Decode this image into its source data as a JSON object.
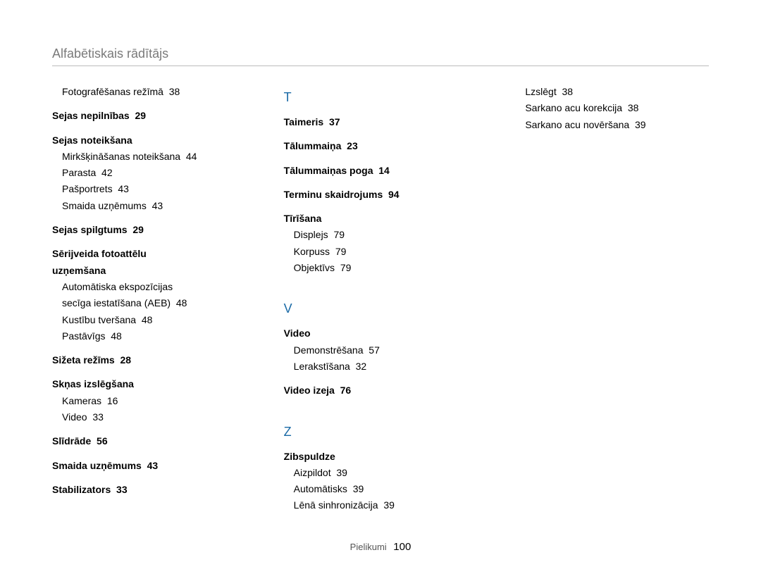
{
  "header": {
    "title": "Alfabētiskais rādītājs"
  },
  "footer": {
    "section": "Pielikumi",
    "page": "100"
  },
  "col1": {
    "e0": {
      "text": "Fotografēšanas režīmā",
      "page": "38"
    },
    "e1": {
      "text": "Sejas nepilnības",
      "page": "29"
    },
    "e2": {
      "text": "Sejas noteikšana"
    },
    "e2s": [
      {
        "text": "Mirkšķināšanas noteikšana",
        "page": "44"
      },
      {
        "text": "Parasta",
        "page": "42"
      },
      {
        "text": "Pašportrets",
        "page": "43"
      },
      {
        "text": "Smaida uzņēmums",
        "page": "43"
      }
    ],
    "e3": {
      "text": "Sejas spilgtums",
      "page": "29"
    },
    "e4a": {
      "text": "Sērijveida fotoattēlu"
    },
    "e4b": {
      "text": "uzņemšana"
    },
    "e4s": [
      {
        "text": "Automātiska ekspozīcijas"
      },
      {
        "text": "secīga iestatīšana (AEB)",
        "page": "48"
      },
      {
        "text": "Kustību tveršana",
        "page": "48"
      },
      {
        "text": "Pastāvīgs",
        "page": "48"
      }
    ],
    "e5": {
      "text": "Sižeta režīms",
      "page": "28"
    },
    "e6": {
      "text": "Skņas izslēgšana"
    },
    "e6s": [
      {
        "text": "Kameras",
        "page": "16"
      },
      {
        "text": "Video",
        "page": "33"
      }
    ],
    "e7": {
      "text": "Slīdrāde",
      "page": "56"
    },
    "e8": {
      "text": "Smaida uzņēmums",
      "page": "43"
    },
    "e9": {
      "text": "Stabilizators",
      "page": "33"
    }
  },
  "col2": {
    "letterT": "T",
    "t1": {
      "text": "Taimeris",
      "page": "37"
    },
    "t2": {
      "text": "Tālummaiņa",
      "page": "23"
    },
    "t3": {
      "text": "Tālummaiņas poga",
      "page": "14"
    },
    "t4": {
      "text": "Terminu skaidrojums",
      "page": "94"
    },
    "t5": {
      "text": "Tīrīšana"
    },
    "t5s": [
      {
        "text": "Displejs",
        "page": "79"
      },
      {
        "text": "Korpuss",
        "page": "79"
      },
      {
        "text": "Objektīvs",
        "page": "79"
      }
    ],
    "letterV": "V",
    "v1": {
      "text": "Video"
    },
    "v1s": [
      {
        "text": "Demonstrēšana",
        "page": "57"
      },
      {
        "text": "Lerakstīšana",
        "page": "32"
      }
    ],
    "v2": {
      "text": "Video izeja",
      "page": "76"
    },
    "letterZ": "Z",
    "z1": {
      "text": "Zibspuldze"
    },
    "z1s": [
      {
        "text": "Aizpildot",
        "page": "39"
      },
      {
        "text": "Automātisks",
        "page": "39"
      },
      {
        "text": "Lēnā sinhronizācija",
        "page": "39"
      }
    ]
  },
  "col3": {
    "r": [
      {
        "text": "Lzslēgt",
        "page": "38"
      },
      {
        "text": "Sarkano acu korekcija",
        "page": "38"
      },
      {
        "text": "Sarkano acu novēršana",
        "page": "39"
      }
    ]
  }
}
